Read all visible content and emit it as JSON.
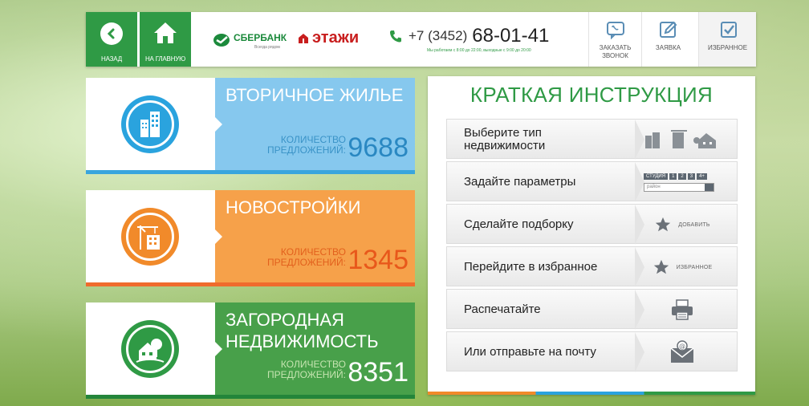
{
  "topbar": {
    "back_label": "НАЗАД",
    "home_label": "НА ГЛАВНУЮ",
    "sber_name": "СБЕРБАНК",
    "sber_tagline": "Всегда рядом",
    "etazhi_name": "этажи",
    "phone_code": "+7 (3452)",
    "phone_number": "68-01-41",
    "work_hours": "Мы работаем с 8:00 до 22:00, выходные с 9:00 до 20:00",
    "order_call_label": "ЗАКАЗАТЬ ЗВОНОК",
    "request_label": "ЗАЯВКА",
    "favorites_label": "ИЗБРАННОЕ"
  },
  "categories": [
    {
      "title": "ВТОРИЧНОЕ ЖИЛЬЕ",
      "count_label_1": "КОЛИЧЕСТВО",
      "count_label_2": "ПРЕДЛОЖЕНИЙ:",
      "count": "9688",
      "icon": "apartment-building-icon"
    },
    {
      "title": "НОВОСТРОЙКИ",
      "count_label_1": "КОЛИЧЕСТВО",
      "count_label_2": "ПРЕДЛОЖЕНИЙ:",
      "count": "1345",
      "icon": "construction-crane-icon"
    },
    {
      "title_1": "ЗАГОРОДНАЯ",
      "title_2": "НЕДВИЖИМОСТЬ",
      "count_label_1": "КОЛИЧЕСТВО",
      "count_label_2": "ПРЕДЛОЖЕНИЙ:",
      "count": "8351",
      "icon": "country-house-icon"
    }
  ],
  "instruction": {
    "title": "КРАТКАЯ ИНСТРУКЦИЯ",
    "steps": [
      {
        "text_1": "Выберите тип",
        "text_2": "недвижимости",
        "icon": "property-types-icon"
      },
      {
        "text": "Задайте параметры",
        "icon": "parameters-icon",
        "rooms": [
          "СТУДИЯ",
          "1",
          "2",
          "3",
          "4+"
        ],
        "district": "район"
      },
      {
        "text": "Сделайте подборку",
        "icon": "star-icon",
        "caption": "ДОБАВИТЬ"
      },
      {
        "text": "Перейдите в избранное",
        "icon": "star-icon",
        "caption": "ИЗБРАННОЕ"
      },
      {
        "text": "Распечатайте",
        "icon": "printer-icon"
      },
      {
        "text": "Или отправьте на почту",
        "icon": "email-icon"
      }
    ]
  },
  "colors": {
    "green": "#2f9a45",
    "blue": "#2aa3de",
    "orange": "#f18a2a",
    "light_blue": "#86c8ee",
    "light_orange": "#f6a14a"
  }
}
